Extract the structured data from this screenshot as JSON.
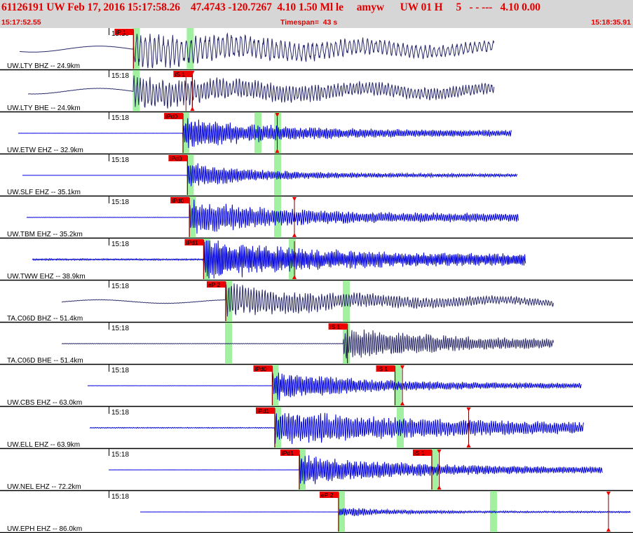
{
  "header": {
    "title": "61126191 UW Feb 17, 2016 15:17:58.26    47.4743 -120.7267  4.10 1.50 Ml le     amyw      UW 01 H     5   - - ---   4.10 0.00",
    "start_time": "15:17:52.55",
    "timespan": "Timespan=  43 s",
    "end_time": "15:18:35.91"
  },
  "colors": {
    "header_bg": "#d6d6d6",
    "header_text": "#e00000",
    "trace_blue": "#0000dd",
    "trace_navy": "#2a2a6a",
    "pick_flag": "#ee0000",
    "window_green": "#90ee90",
    "separator": "#000000"
  },
  "minute_mark": "15:18",
  "traces": [
    {
      "label": "UW.LTY BHZ -- 24.9km",
      "color": "navy",
      "start": 0.0,
      "end": 1.0,
      "onset": 0.272,
      "amp": 1.4,
      "pre": 0.01,
      "coda": 0.55,
      "decay": 0.25,
      "freq": 1.1,
      "swell": 0.85,
      "picks": [
        {
          "label": "iP 1",
          "pos": 0.272,
          "flag": true
        }
      ],
      "windows": [
        0.272,
        0.382
      ],
      "triangles": [],
      "ticks": []
    },
    {
      "label": "UW.LTY BHE -- 24.9km",
      "color": "navy",
      "start": 0.0,
      "end": 1.0,
      "onset": 0.272,
      "amp": 1.1,
      "pre": 0.05,
      "coda": 0.6,
      "decay": 0.3,
      "freq": 1.8,
      "swell": 0.8,
      "picks": [
        {
          "label": "iS 1",
          "pos": 0.392,
          "flag": true
        }
      ],
      "windows": [
        0.272
      ],
      "triangles": [
        {
          "pos": 0.392,
          "top": true,
          "bottom": true
        }
      ],
      "ticks": [
        {
          "pos": 0.379
        }
      ]
    },
    {
      "label": "UW.ETW EHZ -- 32.9km",
      "color": "blue",
      "start": 0.0,
      "end": 1.0,
      "onset": 0.373,
      "amp": 1.2,
      "pre": 0.02,
      "coda": 0.35,
      "decay": 0.45,
      "freq": 3.5,
      "swell": 0,
      "picks": [
        {
          "label": "iPd0",
          "pos": 0.373,
          "flag": true
        }
      ],
      "windows": [
        0.373,
        0.52,
        0.56
      ],
      "triangles": [
        {
          "pos": 0.565,
          "top": true,
          "bottom": true
        }
      ],
      "ticks": []
    },
    {
      "label": "UW.SLF EHZ -- 35.1km",
      "color": "blue",
      "start": 0.0,
      "end": 1.0,
      "onset": 0.382,
      "amp": 1.1,
      "pre": 0.01,
      "coda": 0.18,
      "decay": 0.6,
      "freq": 3.5,
      "swell": 0,
      "picks": [
        {
          "label": "iPd0",
          "pos": 0.382,
          "flag": true
        }
      ],
      "windows": [
        0.382,
        0.56
      ],
      "triangles": [],
      "ticks": []
    },
    {
      "label": "UW.TBM EHZ -- 35.2km",
      "color": "blue",
      "start": 0.0,
      "end": 1.0,
      "onset": 0.386,
      "amp": 1.3,
      "pre": 0.06,
      "coda": 0.5,
      "decay": 0.5,
      "freq": 3.2,
      "swell": 0,
      "picks": [
        {
          "label": "iPd0",
          "pos": 0.386,
          "flag": true
        }
      ],
      "windows": [
        0.386,
        0.56
      ],
      "triangles": [
        {
          "pos": 0.6,
          "top": true,
          "bottom": true
        }
      ],
      "ticks": []
    },
    {
      "label": "UW.TWW EHZ -- 38.9km",
      "color": "blue",
      "start": 0.0,
      "end": 1.0,
      "onset": 0.415,
      "amp": 1.6,
      "pre": 0.35,
      "coda": 0.75,
      "decay": 0.5,
      "freq": 4.0,
      "swell": 0,
      "picks": [
        {
          "label": "iPd1",
          "pos": 0.415,
          "flag": true
        }
      ],
      "windows": [
        0.415,
        0.59
      ],
      "triangles": [
        {
          "pos": 0.6,
          "top": false,
          "bottom": true
        }
      ],
      "ticks": []
    },
    {
      "label": "TA.C06D BHZ -- 51.4km",
      "color": "navy",
      "start": 0.0,
      "end": 1.0,
      "onset": 0.46,
      "amp": 1.3,
      "pre": 0.08,
      "coda": 0.35,
      "decay": 0.35,
      "freq": 2.2,
      "swell": 0.5,
      "picks": [
        {
          "label": "eP 2",
          "pos": 0.46,
          "flag": true
        }
      ],
      "windows": [
        0.46,
        0.7
      ],
      "triangles": [],
      "ticks": []
    },
    {
      "label": "TA.C06D BHE -- 51.4km",
      "color": "navy",
      "start": 0.0,
      "end": 1.0,
      "onset": 0.7,
      "amp": 1.3,
      "pre": 0.12,
      "coda": 0.35,
      "decay": 0.4,
      "freq": 3.0,
      "swell": 0,
      "picks": [
        {
          "label": "iS 1",
          "pos": 0.708,
          "flag": true
        }
      ],
      "windows": [
        0.46,
        0.7
      ],
      "triangles": [],
      "ticks": []
    },
    {
      "label": "UW.CBS EHZ -- 63.0km",
      "color": "blue",
      "start": 0.0,
      "end": 1.0,
      "onset": 0.555,
      "amp": 1.2,
      "pre": 0.03,
      "coda": 0.3,
      "decay": 0.5,
      "freq": 3.5,
      "swell": 0,
      "picks": [
        {
          "label": "iPd0",
          "pos": 0.555,
          "flag": true
        },
        {
          "label": "iS 1",
          "pos": 0.805,
          "flag": true
        }
      ],
      "windows": [
        0.555,
        0.805
      ],
      "triangles": [
        {
          "pos": 0.82,
          "top": true,
          "bottom": true
        }
      ],
      "ticks": []
    },
    {
      "label": "UW.ELL EHZ -- 63.9km",
      "color": "blue",
      "start": 0.0,
      "end": 1.0,
      "onset": 0.56,
      "amp": 1.3,
      "pre": 0.2,
      "coda": 0.45,
      "decay": 0.25,
      "freq": 3.0,
      "swell": 0,
      "picks": [
        {
          "label": "iPd1",
          "pos": 0.56,
          "flag": true
        }
      ],
      "windows": [
        0.56,
        0.81
      ],
      "triangles": [
        {
          "pos": 0.955,
          "top": true,
          "bottom": true
        }
      ],
      "ticks": []
    },
    {
      "label": "UW.NEL EHZ -- 72.2km",
      "color": "blue",
      "start": 0.0,
      "end": 1.0,
      "onset": 0.61,
      "amp": 1.2,
      "pre": 0.02,
      "coda": 0.35,
      "decay": 0.45,
      "freq": 3.5,
      "swell": 0,
      "picks": [
        {
          "label": "iPd1",
          "pos": 0.61,
          "flag": true
        },
        {
          "label": "iS 1",
          "pos": 0.88,
          "flag": true
        }
      ],
      "windows": [
        0.61,
        0.88
      ],
      "triangles": [
        {
          "pos": 0.895,
          "top": true,
          "bottom": true
        }
      ],
      "ticks": []
    },
    {
      "label": "UW.EPH EHZ -- 86.0km",
      "color": "blue",
      "start": 0.0,
      "end": 1.0,
      "onset": 0.69,
      "amp": 0.4,
      "pre": 0.02,
      "coda": 0.1,
      "decay": 0.8,
      "freq": 3.5,
      "swell": 0,
      "picks": [
        {
          "label": "eP 2",
          "pos": 0.69,
          "flag": true
        }
      ],
      "windows": [
        0.69,
        1.0
      ],
      "triangles": [
        {
          "pos": 1.24,
          "top": true,
          "bottom": true
        }
      ],
      "ticks": []
    }
  ]
}
